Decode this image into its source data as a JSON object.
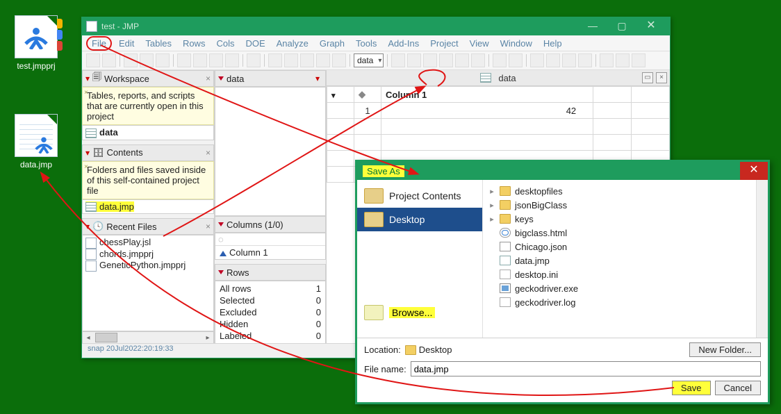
{
  "desktop": {
    "icons": [
      {
        "label": "test.jmpprj"
      },
      {
        "label": "data.jmp"
      }
    ]
  },
  "window": {
    "title": "test - JMP",
    "menu": [
      "File",
      "Edit",
      "Tables",
      "Rows",
      "Cols",
      "DOE",
      "Analyze",
      "Graph",
      "Tools",
      "Add-Ins",
      "Project",
      "View",
      "Window",
      "Help"
    ],
    "combo": "data",
    "status": "snap  20Jul2022:20:19:33"
  },
  "workspace": {
    "title": "Workspace",
    "note": "Tables, reports, and scripts that are currently open in this project",
    "item": "data"
  },
  "contents": {
    "title": "Contents",
    "note": "Folders and files saved inside of this self-contained project file",
    "item": "data.jmp"
  },
  "recent": {
    "title": "Recent Files",
    "items": [
      "chessPlay.jsl",
      "chords.jmpprj",
      "GeneticPython.jmpprj"
    ]
  },
  "midtop": {
    "label": "data"
  },
  "columns": {
    "title": "Columns (1/0)",
    "filter": "",
    "items": [
      "Column 1"
    ]
  },
  "rows": {
    "title": "Rows",
    "stats": [
      {
        "k": "All rows",
        "v": "1"
      },
      {
        "k": "Selected",
        "v": "0"
      },
      {
        "k": "Excluded",
        "v": "0"
      },
      {
        "k": "Hidden",
        "v": "0"
      },
      {
        "k": "Labeled",
        "v": "0"
      }
    ]
  },
  "sheet": {
    "tab": "data",
    "col": "Column 1",
    "row": "1",
    "val": "42"
  },
  "dialog": {
    "title": "Save As",
    "places": [
      "Project Contents",
      "Desktop",
      "Browse..."
    ],
    "files": [
      {
        "t": "folder",
        "n": "desktopfiles",
        "exp": true
      },
      {
        "t": "folder",
        "n": "jsonBigClass",
        "exp": true
      },
      {
        "t": "folder",
        "n": "keys",
        "exp": true
      },
      {
        "t": "html",
        "n": "bigclass.html"
      },
      {
        "t": "json",
        "n": "Chicago.json"
      },
      {
        "t": "jmp",
        "n": "data.jmp"
      },
      {
        "t": "ini",
        "n": "desktop.ini"
      },
      {
        "t": "exe",
        "n": "geckodriver.exe"
      },
      {
        "t": "log",
        "n": "geckodriver.log"
      }
    ],
    "location_label": "Location:",
    "location_value": "Desktop",
    "filename_label": "File name:",
    "filename_value": "data.jmp",
    "new_folder": "New Folder...",
    "save": "Save",
    "cancel": "Cancel"
  }
}
